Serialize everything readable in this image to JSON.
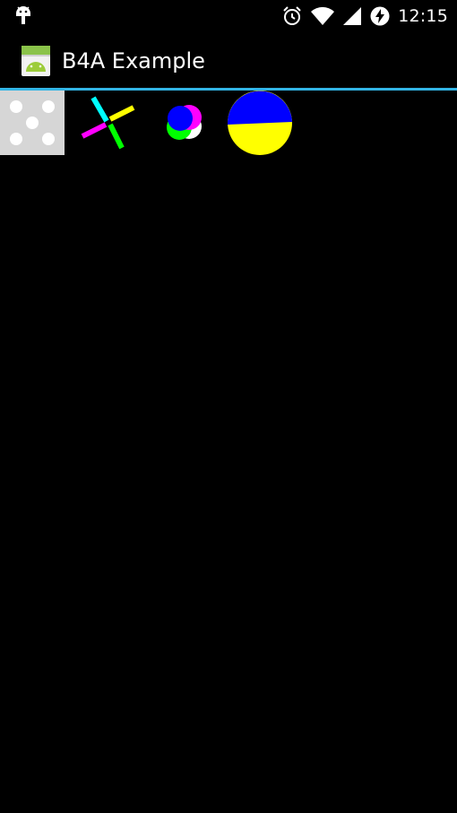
{
  "status_bar": {
    "time": "12:15",
    "icons": [
      "android-debug-icon",
      "alarm-icon",
      "wifi-icon",
      "signal-icon",
      "battery-charging-icon"
    ]
  },
  "action_bar": {
    "title": "B4A Example",
    "icon": "app-launcher-icon",
    "divider_color": "#33b5e5"
  },
  "images": [
    {
      "name": "dice-five-image",
      "colors": [
        "#d6d6d6",
        "#ffffff"
      ]
    },
    {
      "name": "pinwheel-image",
      "colors": [
        "#00ffff",
        "#ffff00",
        "#ff00ff",
        "#00ff00"
      ]
    },
    {
      "name": "overlapping-circles-image",
      "colors": [
        "#0000ff",
        "#ff00ff",
        "#00ff00",
        "#ffffff"
      ]
    },
    {
      "name": "two-tone-circle-image",
      "colors": [
        "#0000ff",
        "#ffff00"
      ]
    }
  ]
}
